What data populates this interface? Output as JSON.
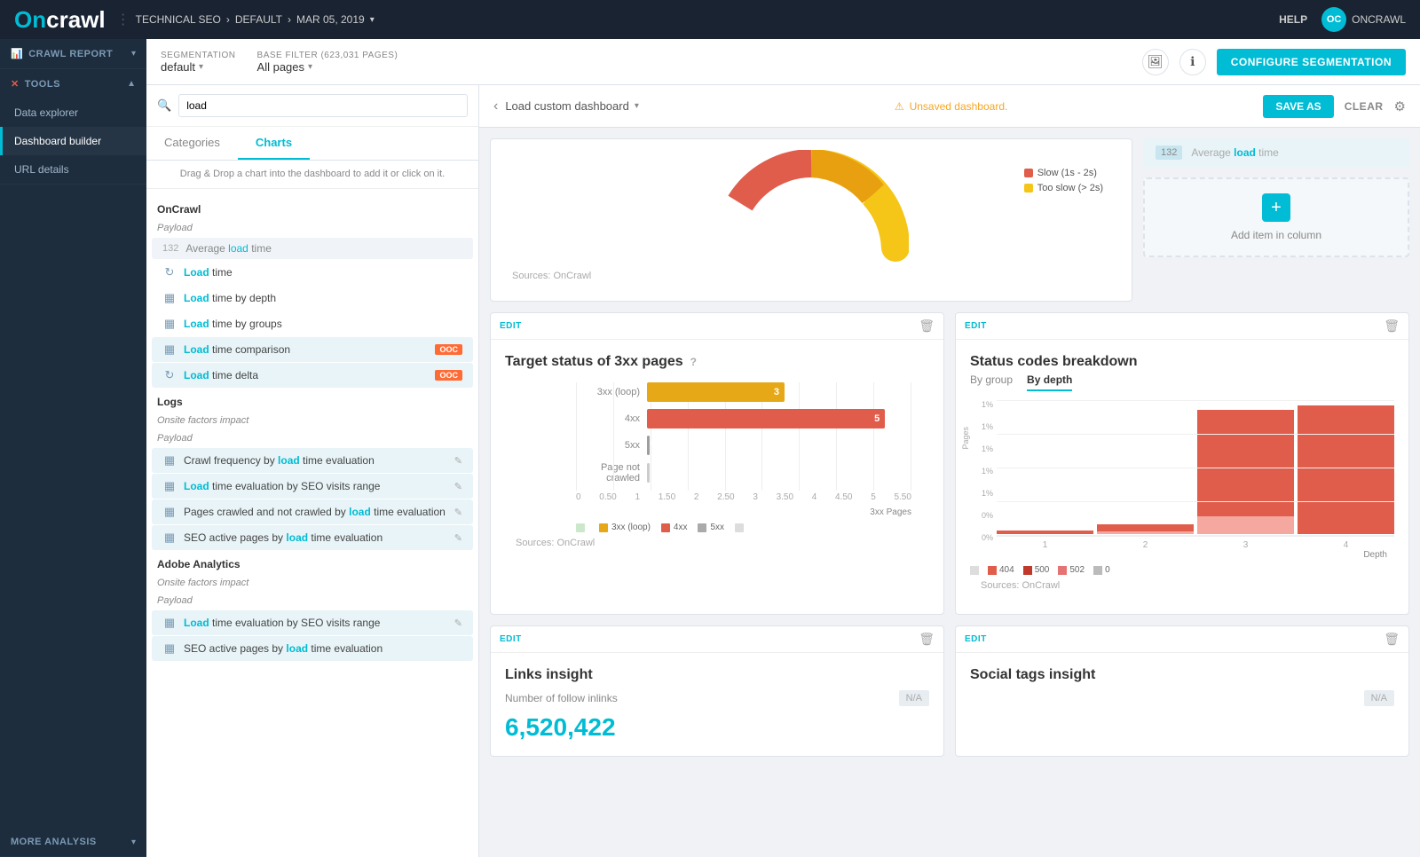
{
  "topnav": {
    "logo_on": "On",
    "logo_crawl": "crawl",
    "breadcrumb": {
      "item1": "TECHNICAL SEO",
      "item2": "DEFAULT",
      "item3": "MAR 05, 2019",
      "sep": "›"
    },
    "help": "HELP",
    "user": "ONCRAWL"
  },
  "filter_bar": {
    "segmentation_label": "Segmentation",
    "segmentation_value": "default",
    "base_filter_label": "Base filter (623,031 pages)",
    "base_filter_value": "All pages",
    "configure_btn": "CONFIGURE SEGMENTATION"
  },
  "sidebar": {
    "crawl_report": "CRAWL REPORT",
    "tools": "TOOLS",
    "items": [
      {
        "label": "Data explorer",
        "active": false
      },
      {
        "label": "Dashboard builder",
        "active": true
      },
      {
        "label": "URL details",
        "active": false
      }
    ],
    "more_analysis": "MORE ANALYSIS"
  },
  "left_panel": {
    "search_placeholder": "load",
    "search_value": "load",
    "tab_categories": "Categories",
    "tab_charts": "Charts",
    "drag_hint": "Drag & Drop a chart into the dashboard to add it or click on it.",
    "group_oncrawl": "OnCrawl",
    "subgroup_payload": "Payload",
    "metric_132": "132",
    "metric_avg": "Average load time",
    "chart_load_time": "Load time",
    "chart_load_depth": "Load time by depth",
    "chart_load_groups": "Load time by groups",
    "chart_load_comparison": "Load time comparison",
    "badge_comparison": "OOC",
    "chart_load_delta": "Load time delta",
    "badge_delta": "OOC",
    "group_logs": "Logs",
    "subgroup_onsite": "Onsite factors impact",
    "subgroup_payload2": "Payload",
    "chart_crawl_freq": "Crawl frequency by load time evaluation",
    "chart_load_seo": "Load time evaluation by SEO visits range",
    "chart_pages_crawled": "Pages crawled and not crawled by load time evaluation",
    "chart_seo_pages": "SEO active pages by load time evaluation",
    "group_adobe": "Adobe Analytics",
    "subgroup_onsite2": "Onsite factors impact",
    "subgroup_payload3": "Payload",
    "chart_load_seo2": "Load time evaluation by SEO visits range",
    "chart_seo_pages2": "SEO active pages by load time evaluation"
  },
  "dashboard_header": {
    "load_custom": "Load custom dashboard",
    "unsaved": "Unsaved dashboard.",
    "save_as": "SAVE AS",
    "clear": "CLEAR"
  },
  "chart1": {
    "edit": "EDIT",
    "title": "Target status of 3xx pages",
    "sources": "Sources: OnCrawl",
    "bars": [
      {
        "label": "3xx (loop)",
        "value": 3,
        "max": 5.5,
        "color": "#e6a817"
      },
      {
        "label": "4xx",
        "value": 5,
        "max": 5.5,
        "color": "#e05c4b"
      },
      {
        "label": "5xx",
        "value": 0,
        "max": 5.5,
        "color": "#9e9e9e"
      },
      {
        "label": "Page not crawled",
        "value": 0,
        "max": 5.5,
        "color": "#ccc"
      }
    ],
    "x_axis": [
      "0",
      "0.50",
      "1",
      "1.50",
      "2",
      "2.50",
      "3",
      "3.50",
      "4",
      "4.50",
      "5",
      "5.50"
    ],
    "x_label": "3xx Pages",
    "legend": [
      {
        "label": "3xx (loop)",
        "color": "#e6a817"
      },
      {
        "label": "4xx",
        "color": "#e05c4b"
      },
      {
        "label": "5xx",
        "color": "#aaa"
      }
    ]
  },
  "chart2": {
    "edit": "EDIT",
    "title": "Status codes breakdown",
    "sources": "Sources: OnCrawl",
    "tab_group": "By group",
    "tab_depth": "By depth",
    "active_tab": "By depth",
    "y_labels": [
      "1%",
      "1%",
      "1%",
      "1%",
      "1%",
      "0%",
      "0%"
    ],
    "x_labels": [
      "1",
      "2",
      "3",
      "4"
    ],
    "x_label": "Depth",
    "legend": [
      {
        "label": "404",
        "color": "#e05c4b"
      },
      {
        "label": "500",
        "color": "#c0392b"
      },
      {
        "label": "502",
        "color": "#e57373"
      },
      {
        "label": "0",
        "color": "#bbb"
      }
    ],
    "columns": [
      {
        "depth": 1,
        "segments": [
          {
            "pct": 2,
            "color": "#e05c4b"
          }
        ]
      },
      {
        "depth": 2,
        "segments": [
          {
            "pct": 5,
            "color": "#e05c4b"
          },
          {
            "pct": 2,
            "color": "#faa"
          }
        ]
      },
      {
        "depth": 3,
        "segments": [
          {
            "pct": 90,
            "color": "#e05c4b"
          },
          {
            "pct": 8,
            "color": "#faa"
          }
        ]
      },
      {
        "depth": 4,
        "segments": [
          {
            "pct": 100,
            "color": "#e05c4b"
          }
        ]
      }
    ]
  },
  "chart3": {
    "edit": "EDIT",
    "title": "Links insight",
    "subtitle": "Number of follow inlinks",
    "value": "6,520,422",
    "na_badge": "N/A"
  },
  "chart4": {
    "edit": "EDIT",
    "title": "Social tags insight",
    "na_badge": "N/A"
  },
  "donut": {
    "legend_slow": "Slow (1s - 2s)",
    "legend_too_slow": "Too slow (> 2s)"
  },
  "avg_load": {
    "num": "132",
    "text": "Average load time",
    "highlight": "load"
  }
}
